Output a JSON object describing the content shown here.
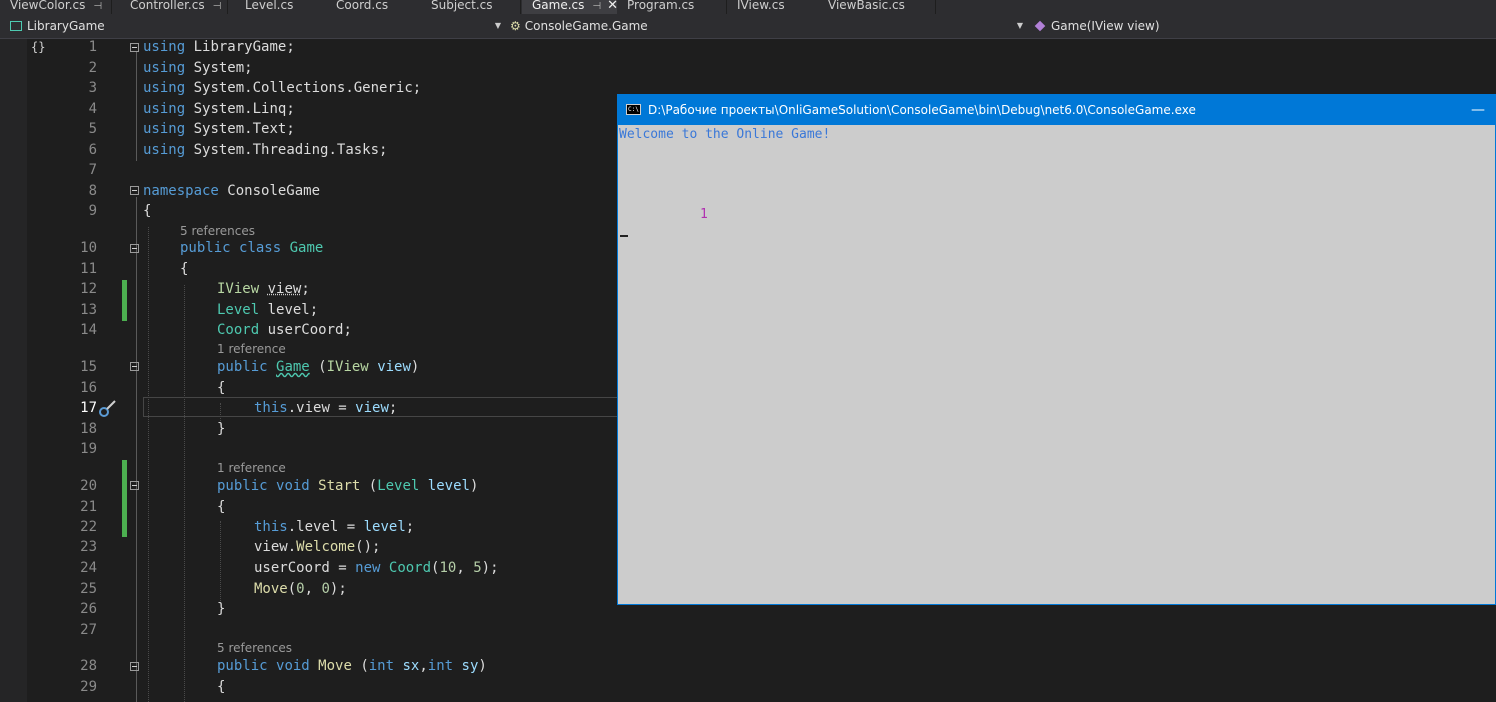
{
  "tabs": [
    {
      "label": "ViewColor.cs",
      "pinned": true
    },
    {
      "label": "Controller.cs",
      "pinned": true
    },
    {
      "label": "Level.cs"
    },
    {
      "label": "Coord.cs"
    },
    {
      "label": "Subject.cs"
    },
    {
      "label": "Game.cs",
      "active": true,
      "pinned": true
    },
    {
      "label": "Program.cs"
    },
    {
      "label": "IView.cs"
    },
    {
      "label": "ViewBasic.cs"
    }
  ],
  "navbar": {
    "project": "LibraryGame",
    "type": "ConsoleGame.Game",
    "member": "Game(IView view)"
  },
  "editor": {
    "current_line": "17",
    "references": {
      "five": "5 references",
      "one": "1 reference"
    },
    "lines": {
      "1": "1",
      "2": "2",
      "3": "3",
      "4": "4",
      "5": "5",
      "6": "6",
      "7": "7",
      "8": "8",
      "9": "9",
      "10": "10",
      "11": "11",
      "12": "12",
      "13": "13",
      "14": "14",
      "15": "15",
      "16": "16",
      "17": "17",
      "18": "18",
      "19": "19",
      "20": "20",
      "21": "21",
      "22": "22",
      "23": "23",
      "24": "24",
      "25": "25",
      "26": "26",
      "27": "27",
      "28": "28",
      "29": "29"
    },
    "tokens": {
      "using": "using",
      "namespace": "namespace",
      "public": "public",
      "class": "class",
      "void": "void",
      "this": "this",
      "new": "new",
      "int": "int",
      "LibraryGame": "LibraryGame",
      "System": "System",
      "Collections_Generic": ".Collections.Generic",
      "Linq": ".Linq",
      "Text": ".Text",
      "Threading_Tasks": ".Threading.Tasks",
      "ConsoleGame": "ConsoleGame",
      "Game": "Game",
      "IView": "IView",
      "Level": "Level",
      "Coord": "Coord",
      "view": "view",
      "level": "level",
      "userCoord": "userCoord",
      "Start": "Start",
      "Move": "Move",
      "Welcome": "Welcome",
      "sx": "sx",
      "sy": "sy",
      "n10": "10",
      "n5": "5",
      "n0": "0"
    }
  },
  "console": {
    "title": "D:\\Рабочие проекты\\OnliGameSolution\\ConsoleGame\\bin\\Debug\\net6.0\\ConsoleGame.exe",
    "icon_text": "C:\\",
    "minimize": "—",
    "welcome": "Welcome to the Online Game!",
    "output_value": "1"
  },
  "colors": {
    "editor_bg": "#1e1e1e",
    "keyword": "#569cd6",
    "type": "#4ec9b0",
    "console_title_bg": "#0078d7",
    "console_bg": "#cccccc",
    "changed_bar": "#4caf50"
  }
}
